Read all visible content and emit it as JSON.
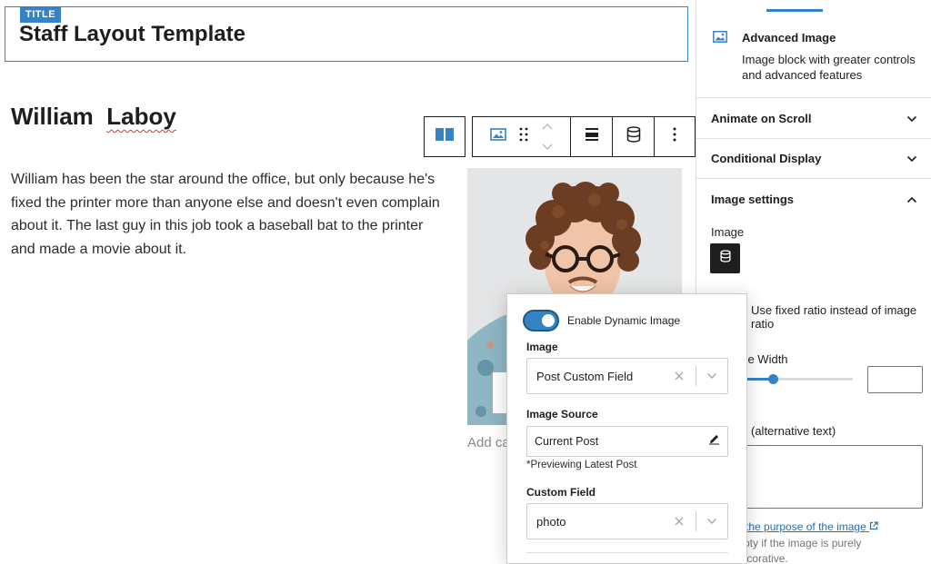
{
  "editor": {
    "title_tag": "TITLE",
    "title": "Staff Layout Template",
    "staff_first": "William",
    "staff_last": "Laboy",
    "bio": "William has been the star around the office, but only because he's fixed the printer more than anyone else and doesn't even complain about it. The last guy in this job took a baseball bat to the printer and made a movie about it.",
    "caption_placeholder": "Add ca"
  },
  "toolbar": {
    "icons": [
      "columns-icon",
      "image-icon",
      "drag-handle-icon",
      "move-up-icon",
      "move-down-icon",
      "align-icon",
      "database-icon",
      "more-options-icon"
    ]
  },
  "sidebar": {
    "block_title": "Advanced Image",
    "block_desc": "Image block with greater controls and advanced features",
    "panels": {
      "animate": "Animate on Scroll",
      "conditional": "Conditional Display",
      "image_settings": "Image settings"
    },
    "image_label": "Image",
    "ratio_text": "Use fixed ratio instead of image ratio",
    "width_label": "age Width",
    "width_slider_percent": 34,
    "alt_label": "(alternative text)",
    "alt_link": "e the purpose of the image",
    "alt_help": "mpty if the image is purely decorative."
  },
  "popover": {
    "toggle_on": true,
    "toggle_label": "Enable Dynamic Image",
    "image_label": "Image",
    "image_value": "Post Custom Field",
    "source_label": "Image Source",
    "source_value": "Current Post",
    "source_note": "*Previewing Latest Post",
    "custom_field_label": "Custom Field",
    "custom_field_value": "photo"
  },
  "colors": {
    "accent": "#3582c4",
    "text": "#1e1e1e",
    "link": "#2271b1",
    "spell_error": "#d63638"
  }
}
